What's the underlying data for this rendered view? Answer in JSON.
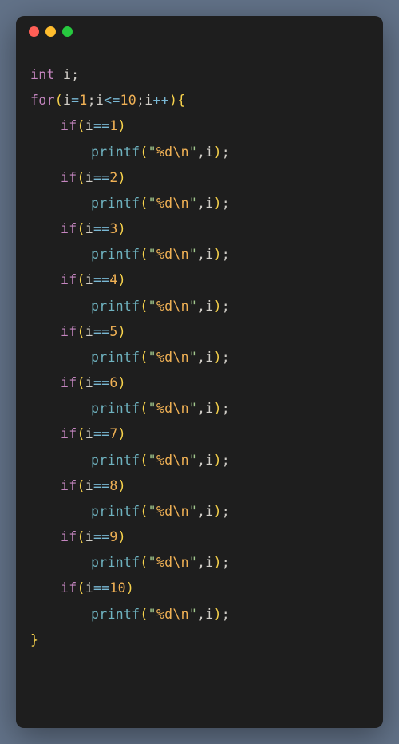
{
  "code": {
    "type_int": "int",
    "var_i": "i",
    "for_kw": "for",
    "if_kw": "if",
    "printf_fn": "printf",
    "assign": "=",
    "lte": "<=",
    "eq": "==",
    "inc": "++",
    "num_1": "1",
    "num_2": "2",
    "num_3": "3",
    "num_4": "4",
    "num_5": "5",
    "num_6": "6",
    "num_7": "7",
    "num_8": "8",
    "num_9": "9",
    "num_10": "10",
    "semicolon": ";",
    "comma": ",",
    "lparen": "(",
    "rparen": ")",
    "lbrace": "{",
    "rbrace": "}",
    "quote": "\"",
    "fmt_pct_d": "%d",
    "fmt_newline": "\\n"
  }
}
